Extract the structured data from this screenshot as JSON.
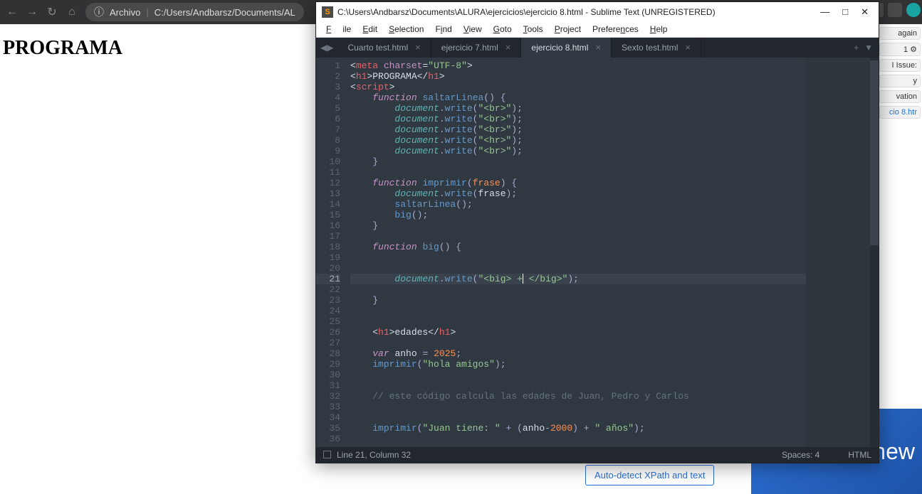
{
  "browser": {
    "archivo_label": "Archivo",
    "url": "C:/Users/Andbarsz/Documents/AL"
  },
  "page": {
    "heading": "PROGRAMA"
  },
  "right_side": {
    "again": "again",
    "one": "1",
    "issue": "I Issue:",
    "y": "y",
    "vation": "vation",
    "link": "cio 8.htr"
  },
  "autodetect_btn": "Auto-detect XPath and text",
  "bottom_word": "new",
  "sublime": {
    "title": "C:\\Users\\Andbarsz\\Documents\\ALURA\\ejercicios\\ejercicio 8.html - Sublime Text (UNREGISTERED)",
    "menu": [
      "File",
      "Edit",
      "Selection",
      "Find",
      "View",
      "Goto",
      "Tools",
      "Project",
      "Preferences",
      "Help"
    ],
    "tabs": [
      {
        "label": "Cuarto test.html",
        "active": false
      },
      {
        "label": "ejercicio 7.html",
        "active": false
      },
      {
        "label": "ejercicio 8.html",
        "active": true
      },
      {
        "label": "Sexto test.html",
        "active": false
      }
    ],
    "status": {
      "pos": "Line 21, Column 32",
      "spaces": "Spaces: 4",
      "lang": "HTML"
    },
    "lines": {
      "count": 36,
      "highlight": 21
    },
    "code": {
      "l1_attr": "charset",
      "l1_val": "\"UTF-8\"",
      "l2_text": "PROGRAMA",
      "fn_saltar": "saltarLinea",
      "fn_imprimir": "imprimir",
      "fn_big": "big",
      "param_frase": "frase",
      "doc": "document",
      "write": "write",
      "br": "\"<br>\"",
      "hr": "\"<hr>\"",
      "big_open": "\"<big> +",
      "big_close": " </big>\"",
      "h1_edades": "edades",
      "var_kw": "var",
      "anho": "anho",
      "eq": "=",
      "year": "2025",
      "hola": "\"hola amigos\"",
      "comment": "// este código calcula las edades de Juan, Pedro y Carlos",
      "juan": "\"Juan tiene: \"",
      "y2000": "2000",
      "anios": "\" años\""
    }
  }
}
